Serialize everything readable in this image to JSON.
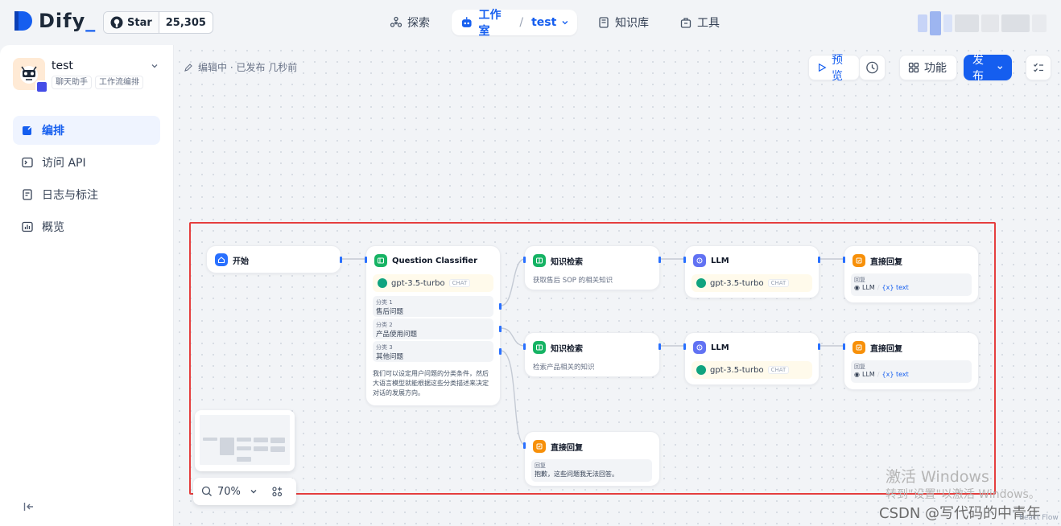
{
  "brand": {
    "name": "Dify",
    "dot": "_"
  },
  "github": {
    "star_label": "Star",
    "count": "25,305"
  },
  "nav": {
    "explore": "探索",
    "studio": "工作室",
    "studio_app": "test",
    "knowledge": "知识库",
    "tools": "工具"
  },
  "app": {
    "name": "test",
    "tag_mode": "聊天助手",
    "tag_type": "工作流编排"
  },
  "sidebar": {
    "items": [
      {
        "label": "编排"
      },
      {
        "label": "访问 API"
      },
      {
        "label": "日志与标注"
      },
      {
        "label": "概览"
      }
    ]
  },
  "status": {
    "text": "编辑中 · 已发布 几秒前"
  },
  "toolbar": {
    "preview": "预览",
    "features": "功能",
    "publish": "发布"
  },
  "nodes": {
    "start": {
      "title": "开始"
    },
    "classifier": {
      "title": "Question Classifier",
      "model": "gpt-3.5-turbo",
      "model_mode": "CHAT",
      "classes": [
        {
          "tag": "分类 1",
          "value": "售后问题"
        },
        {
          "tag": "分类 2",
          "value": "产品使用问题"
        },
        {
          "tag": "分类 3",
          "value": "其他问题"
        }
      ],
      "description": "我们可以设定用户问题的分类条件，然后大语言模型就能根据这些分类描述来决定对话的发展方向。"
    },
    "kr1": {
      "title": "知识检索",
      "desc": "获取售后 SOP 的相关知识"
    },
    "kr2": {
      "title": "知识检索",
      "desc": "检索产品相关的知识"
    },
    "llm1": {
      "title": "LLM",
      "model": "gpt-3.5-turbo",
      "model_mode": "CHAT"
    },
    "llm2": {
      "title": "LLM",
      "model": "gpt-3.5-turbo",
      "model_mode": "CHAT"
    },
    "ans1": {
      "title": "直接回复",
      "label": "回复",
      "src": "LLM",
      "var": "{x} text"
    },
    "ans2": {
      "title": "直接回复",
      "label": "回复",
      "src": "LLM",
      "var": "{x} text"
    },
    "ans3": {
      "title": "直接回复",
      "label": "回复",
      "text": "抱歉，这些问题我无法回答。"
    }
  },
  "zoom": {
    "level": "70%"
  },
  "watermark": {
    "line1": "激活 Windows",
    "line2": "转到\"设置\"以激活 Windows。",
    "csdn": "CSDN @写代码的中青年",
    "reactflow": "React Flow"
  },
  "colors": {
    "accent": "#155eef",
    "highlight_box": "#e53e3e"
  }
}
